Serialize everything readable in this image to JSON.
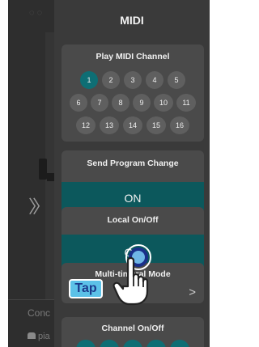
{
  "panel": {
    "title": "MIDI"
  },
  "play_channel": {
    "title": "Play MIDI Channel",
    "selected": "1",
    "rows": [
      [
        "1",
        "2",
        "3",
        "4",
        "5"
      ],
      [
        "6",
        "7",
        "8",
        "9",
        "10",
        "11"
      ],
      [
        "12",
        "13",
        "14",
        "15",
        "16"
      ]
    ]
  },
  "send_program_change": {
    "title": "Send Program Change",
    "value": "ON"
  },
  "local_onoff": {
    "title": "Local On/Off",
    "value": "ON"
  },
  "multi_timbral": {
    "title": "Multi-timbral Mode"
  },
  "channel_onoff": {
    "title": "Channel On/Off"
  },
  "background": {
    "conc_label": "Conc",
    "pia_label": "pia"
  },
  "overlay": {
    "tap_label": "Tap"
  },
  "colors": {
    "panel_bg": "#3a3a3a",
    "card_bg": "#4a4a4a",
    "accent_teal": "#0c585c",
    "tap_badge": "#5cc1e8"
  },
  "icons": {
    "expand": "double-chevron-right-icon",
    "next": "chevron-right-icon",
    "hand": "pointing-hand-icon",
    "piano": "piano-icon"
  }
}
